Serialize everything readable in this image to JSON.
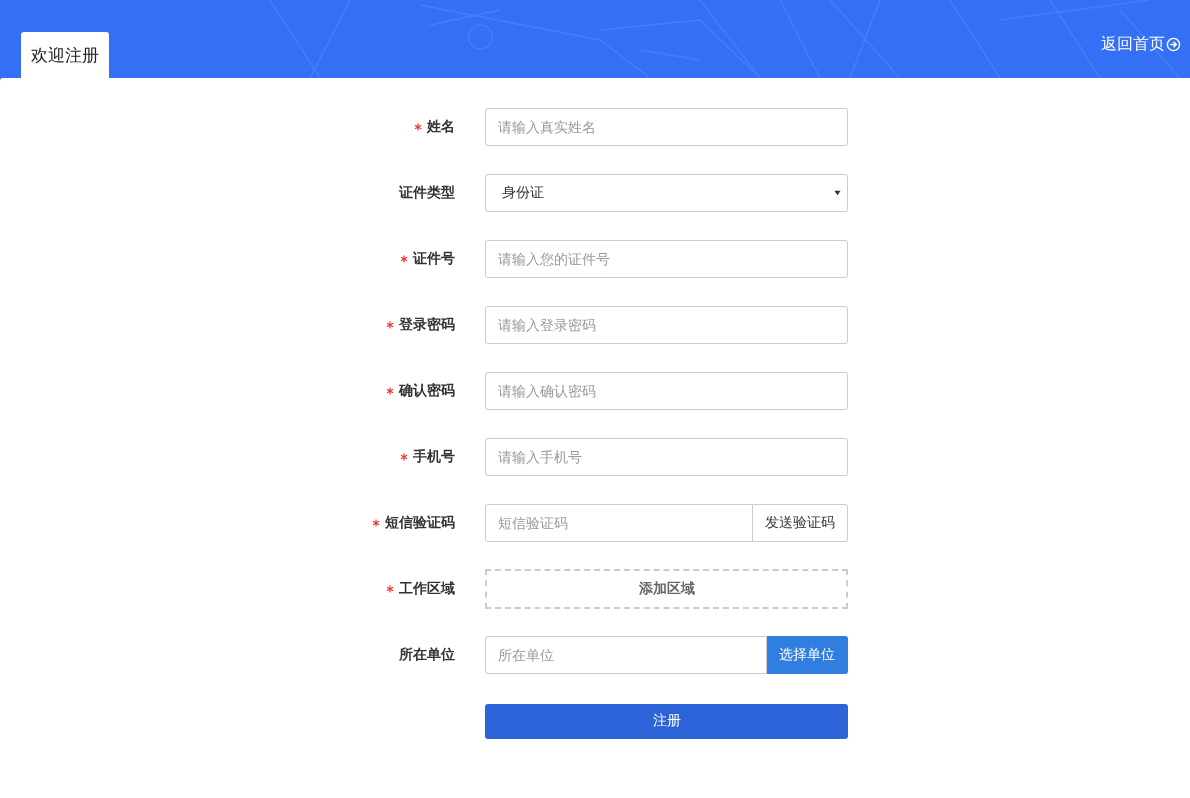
{
  "header": {
    "tab": "欢迎注册",
    "back_link": "返回首页"
  },
  "fields": [
    {
      "kind": "text",
      "label": "姓名",
      "required": true,
      "placeholder": "请输入真实姓名"
    },
    {
      "kind": "select",
      "label": "证件类型",
      "required": false,
      "value": "身份证"
    },
    {
      "kind": "text",
      "label": "证件号",
      "required": true,
      "placeholder": "请输入您的证件号"
    },
    {
      "kind": "text",
      "label": "登录密码",
      "required": true,
      "placeholder": "请输入登录密码"
    },
    {
      "kind": "text",
      "label": "确认密码",
      "required": true,
      "placeholder": "请输入确认密码"
    },
    {
      "kind": "text",
      "label": "手机号",
      "required": true,
      "placeholder": "请输入手机号"
    },
    {
      "kind": "addon",
      "label": "短信验证码",
      "required": true,
      "placeholder": "短信验证码",
      "button": "发送验证码"
    },
    {
      "kind": "dashed",
      "label": "工作区域",
      "required": true,
      "button": "添加区域"
    },
    {
      "kind": "addon-primary",
      "label": "所在单位",
      "required": false,
      "placeholder": "所在单位",
      "button": "选择单位"
    }
  ],
  "submit": "注册"
}
